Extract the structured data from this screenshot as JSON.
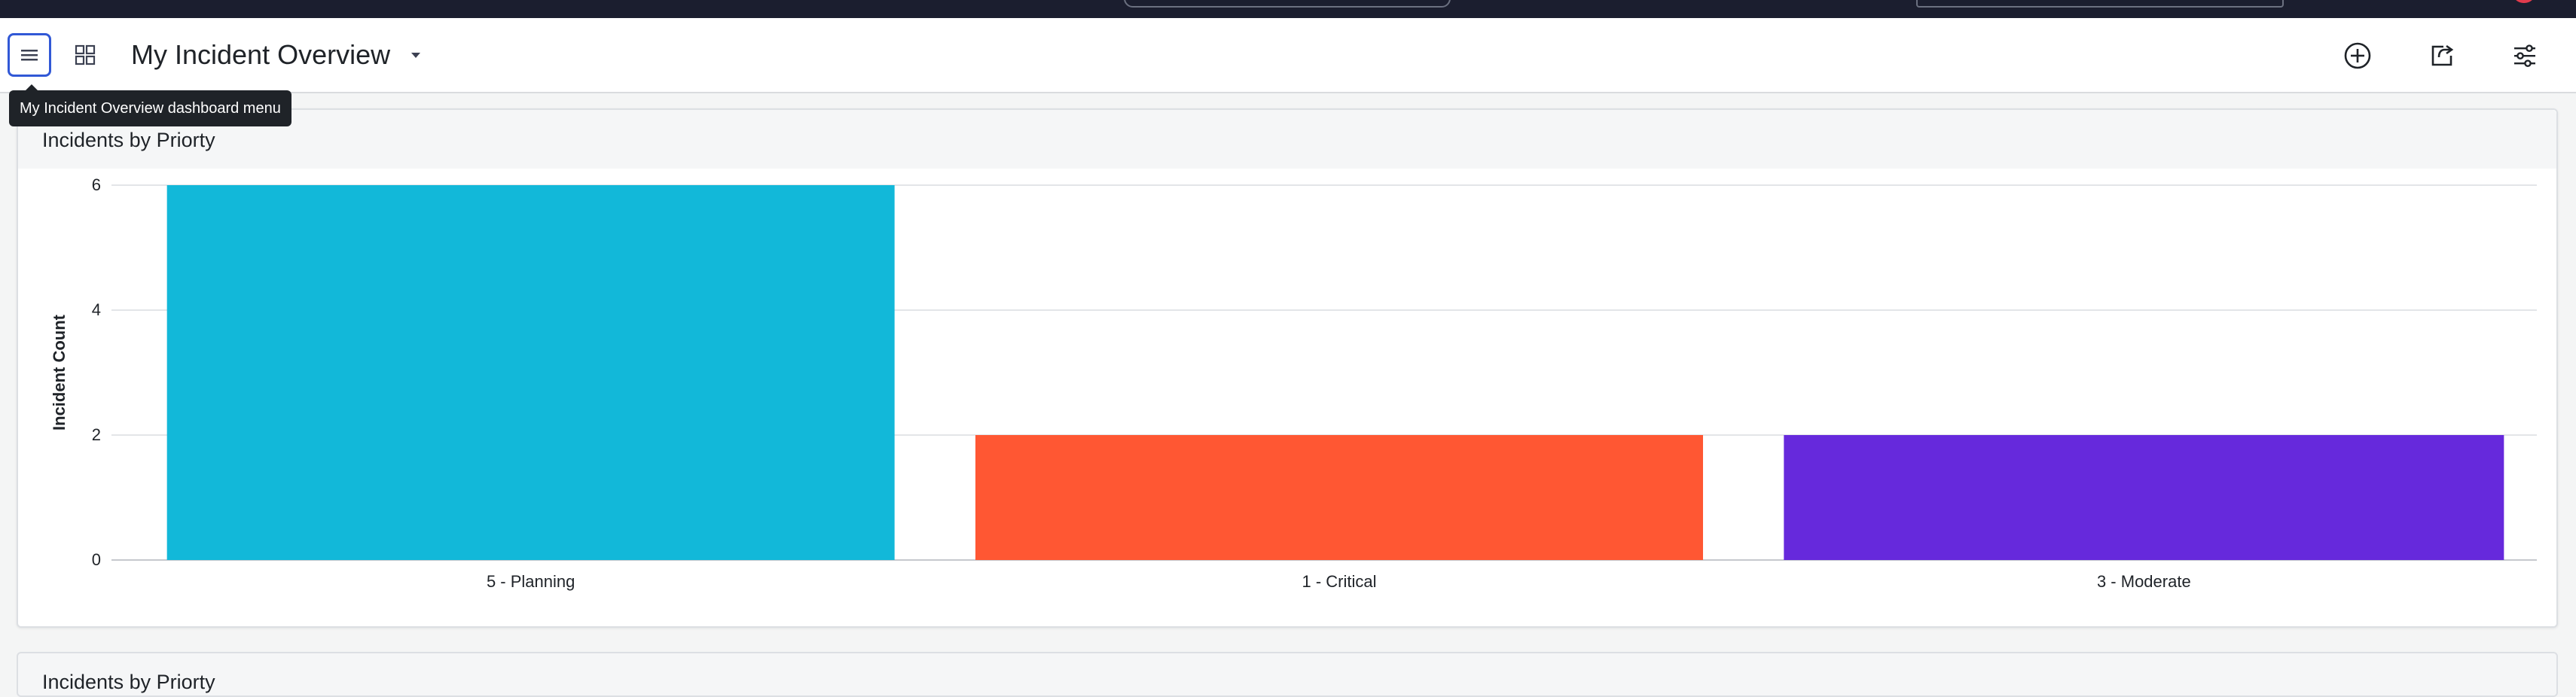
{
  "dashboard": {
    "title": "My Incident Overview",
    "menu_tooltip": "My Incident Overview dashboard menu"
  },
  "toolbar": {
    "icons": [
      "menu-icon",
      "grid-icon",
      "caret-down-icon",
      "add-circle-icon",
      "share-icon",
      "sliders-icon"
    ]
  },
  "widgets": [
    {
      "title": "Incidents by Priorty"
    },
    {
      "title": "Incidents by Priorty"
    }
  ],
  "chart_data": {
    "type": "bar",
    "title": "Incidents by Priorty",
    "xlabel": "",
    "ylabel": "Incident Count",
    "categories": [
      "5 - Planning",
      "1 - Critical",
      "3 - Moderate"
    ],
    "values": [
      6,
      2,
      2
    ],
    "colors": [
      "#12b8d9",
      "#ff5733",
      "#6629dc"
    ],
    "ylim": [
      0,
      6
    ],
    "yticks": [
      0,
      2,
      4,
      6
    ],
    "grid": true,
    "legend": "none"
  }
}
